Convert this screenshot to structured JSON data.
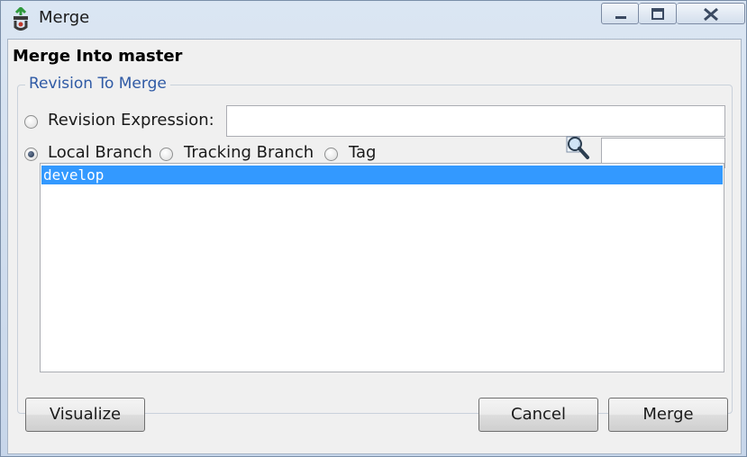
{
  "window": {
    "title": "Merge"
  },
  "dialog": {
    "heading": "Merge Into master"
  },
  "revision_group": {
    "legend": "Revision To Merge",
    "options": {
      "revision_expression": {
        "label": "Revision Expression:",
        "checked": false
      },
      "local_branch": {
        "label": "Local Branch",
        "checked": true
      },
      "tracking_branch": {
        "label": "Tracking Branch",
        "checked": false
      },
      "tag": {
        "label": "Tag",
        "checked": false
      }
    },
    "revision_expression_value": "",
    "filter_value": "",
    "branches": [
      {
        "name": "develop",
        "selected": true
      }
    ]
  },
  "buttons": {
    "visualize": "Visualize",
    "cancel": "Cancel",
    "merge": "Merge"
  },
  "icons": {
    "app": "merge-app-icon",
    "filter": "magnifier-icon",
    "minimize": "minimize-icon",
    "maximize": "maximize-icon",
    "close": "close-icon"
  },
  "colors": {
    "selection": "#3399ff",
    "legend_text": "#2f5aa5"
  }
}
